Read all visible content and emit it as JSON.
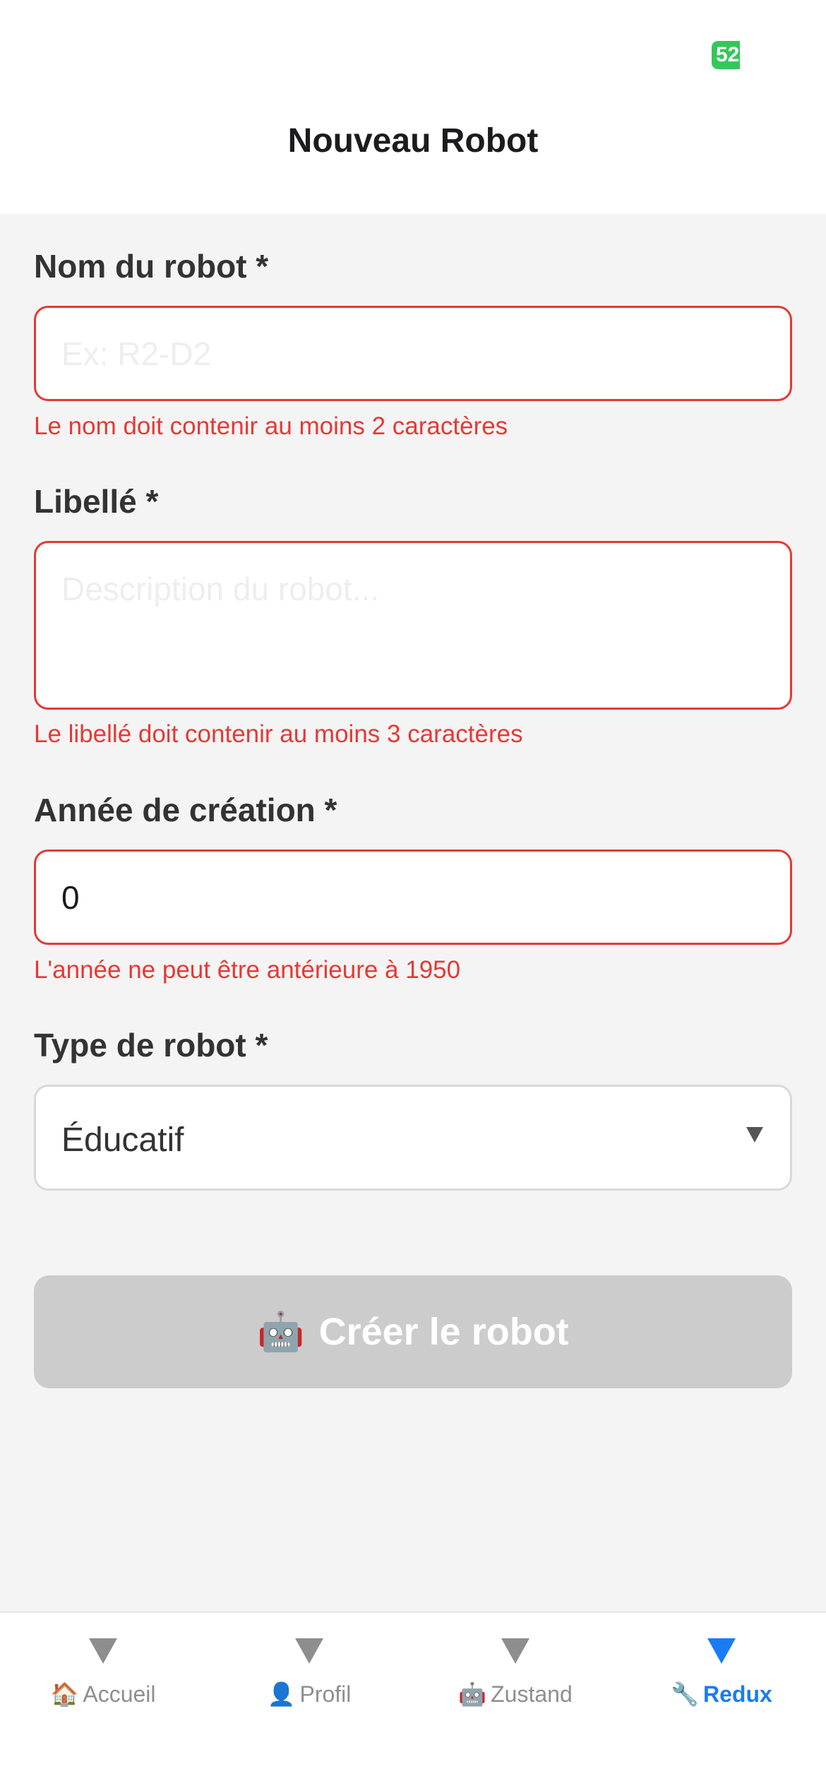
{
  "status": {
    "badge_text": "52"
  },
  "header": {
    "title": "Nouveau Robot"
  },
  "form": {
    "name": {
      "label": "Nom du robot *",
      "placeholder": "Ex: R2-D2",
      "value": "",
      "error": "Le nom doit contenir au moins 2 caractères"
    },
    "libelle": {
      "label": "Libellé *",
      "placeholder": "Description du robot...",
      "value": "",
      "error": "Le libellé doit contenir au moins 3 caractères"
    },
    "year": {
      "label": "Année de création *",
      "value": "0",
      "error": "L'année ne peut être antérieure à 1950"
    },
    "type": {
      "label": "Type de robot *",
      "selected": "Éducatif"
    },
    "submit": {
      "icon": "🤖",
      "label": "Créer le robot"
    }
  },
  "tabs": [
    {
      "emoji": "🏠",
      "label": "Accueil",
      "active": false
    },
    {
      "emoji": "👤",
      "label": "Profil",
      "active": false
    },
    {
      "emoji": "🤖",
      "label": "Zustand",
      "active": false
    },
    {
      "emoji": "🔧",
      "label": "Redux",
      "active": true
    }
  ],
  "colors": {
    "error": "#e53935",
    "active_tab": "#1a7cf5",
    "inactive_tab": "#8e8e8e",
    "disabled_button": "#cccccc",
    "status_badge": "#34c759"
  }
}
